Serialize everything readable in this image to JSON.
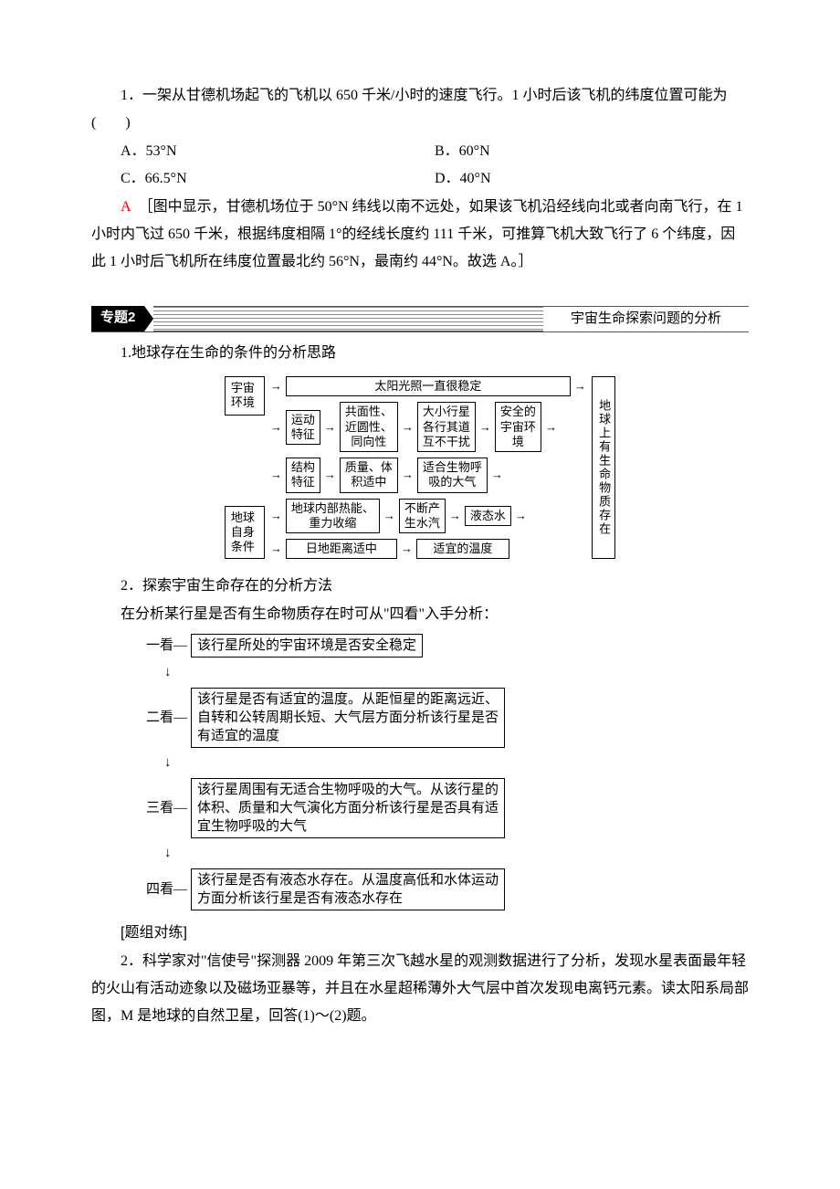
{
  "q1": {
    "stem": "1．一架从甘德机场起飞的飞机以 650 千米/小时的速度飞行。1 小时后该飞机的纬度位置可能为(　　)",
    "A": "A．53°N",
    "B": "B．60°N",
    "C": "C．66.5°N",
    "D": "D．40°N",
    "answer_letter": "A",
    "explanation": "［图中显示，甘德机场位于 50°N 纬线以南不远处，如果该飞机沿经线向北或者向南飞行，在 1 小时内飞过 650 千米，根据纬度相隔 1°的经线长度约 111 千米，可推算飞机大致飞行了 6 个纬度，因此 1 小时后飞机所在纬度位置最北约 56°N，最南约 44°N。故选 A。］"
  },
  "topic2": {
    "label": "专题2",
    "title": "宇宙生命探索问题的分析"
  },
  "section1_title": "1.地球存在生命的条件的分析思路",
  "diagram1": {
    "left_env": "宇宙\n环境",
    "left_self": "地球\n自身\n条件",
    "row1_a": "太阳光照一直很稳定",
    "row2_a": "运动\n特征",
    "row2_b": "共面性、\n近圆性、\n同向性",
    "row2_c": "大小行星\n各行其道\n互不干扰",
    "row2_d": "安全的\n宇宙环\n境",
    "row3_a": "结构\n特征",
    "row3_b": "质量、体\n积适中",
    "row3_c": "适合生物呼\n吸的大气",
    "row4_a": "地球内部热能、\n重力收缩",
    "row4_b": "不断产\n生水汽",
    "row4_c": "液态水",
    "row5_a": "日地距离适中",
    "row5_b": "适宜的温度",
    "right": "地球上有生命物质存在"
  },
  "section2_title": "2．探索宇宙生命存在的分析方法",
  "section2_intro": "在分析某行星是否有生命物质存在时可从\"四看\"入手分析：",
  "look1": {
    "label": "一看—",
    "text": "该行星所处的宇宙环境是否安全稳定"
  },
  "look2": {
    "label": "二看—",
    "text": "该行星是否有适宜的温度。从距恒星的距离远近、自转和公转周期长短、大气层方面分析该行星是否有适宜的温度"
  },
  "look3": {
    "label": "三看—",
    "text": "该行星周围有无适合生物呼吸的大气。从该行星的体积、质量和大气演化方面分析该行星是否具有适宜生物呼吸的大气"
  },
  "look4": {
    "label": "四看—",
    "text": "该行星是否有液态水存在。从温度高低和水体运动方面分析该行星是否有液态水存在"
  },
  "practice_label": "[题组对练]",
  "q2": {
    "stem": "2．科学家对\"信使号\"探测器 2009 年第三次飞越水星的观测数据进行了分析，发现水星表面最年轻的火山有活动迹象以及磁场亚暴等，并且在水星超稀薄外大气层中首次发现电离钙元素。读太阳系局部图，M 是地球的自然卫星，回答(1)～(2)题。"
  },
  "arrow_down": "↓",
  "arrow_right": "→"
}
